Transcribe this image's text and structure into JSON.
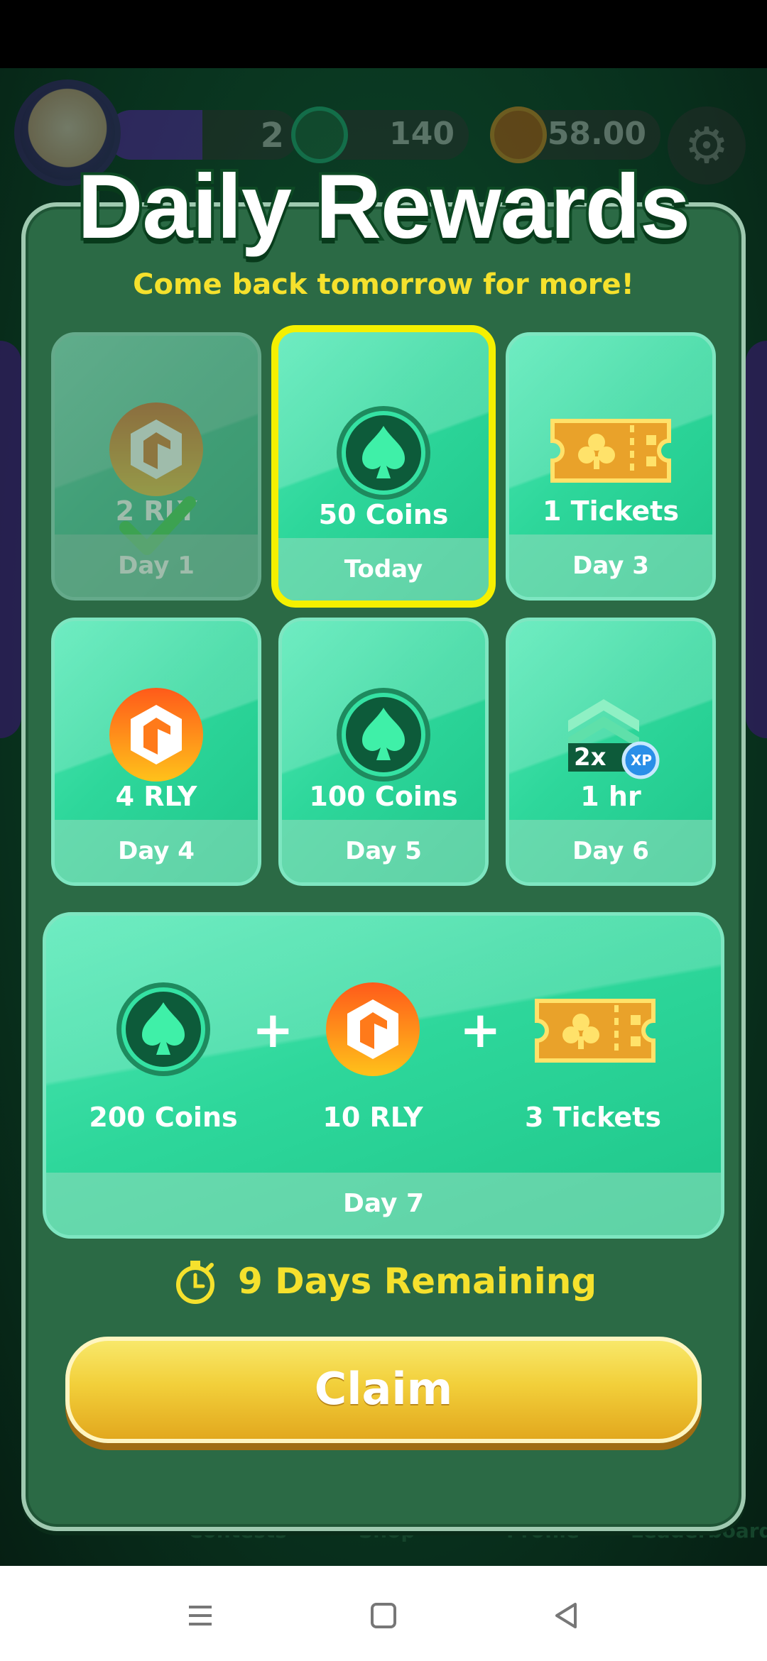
{
  "top_bar": {
    "level": "2",
    "coins": "140",
    "rly": "58.00"
  },
  "bottom_nav_behind": [
    "Contests",
    "Shop",
    "Profile",
    "Leaderboard"
  ],
  "modal": {
    "title": "Daily Rewards",
    "subtitle": "Come back tomorrow for more!",
    "days": [
      {
        "value": "2 RLY",
        "label": "Day 1",
        "icon": "rly-icon",
        "state": "claimed"
      },
      {
        "value": "50 Coins",
        "label": "Today",
        "icon": "spade-coin-icon",
        "state": "today"
      },
      {
        "value": "1 Tickets",
        "label": "Day 3",
        "icon": "ticket-icon",
        "state": "upcoming"
      },
      {
        "value": "4 RLY",
        "label": "Day 4",
        "icon": "rly-icon",
        "state": "upcoming"
      },
      {
        "value": "100 Coins",
        "label": "Day 5",
        "icon": "spade-coin-icon",
        "state": "upcoming"
      },
      {
        "value": "1 hr",
        "label": "Day 6",
        "icon": "xp-boost-icon",
        "state": "upcoming"
      }
    ],
    "day7": {
      "label": "Day 7",
      "items": [
        {
          "value": "200 Coins",
          "icon": "spade-coin-icon"
        },
        {
          "value": "10 RLY",
          "icon": "rly-icon"
        },
        {
          "value": "3 Tickets",
          "icon": "ticket-icon"
        }
      ]
    },
    "xp_badge": {
      "multiplier": "2x",
      "xp": "XP"
    },
    "remaining": "9 Days Remaining",
    "claim_label": "Claim"
  },
  "colors": {
    "card_green": "#2ed79b",
    "highlight_yellow": "#f5f000",
    "accent_yellow": "#f5e12d",
    "claim_gold": "#f2cf3a"
  }
}
